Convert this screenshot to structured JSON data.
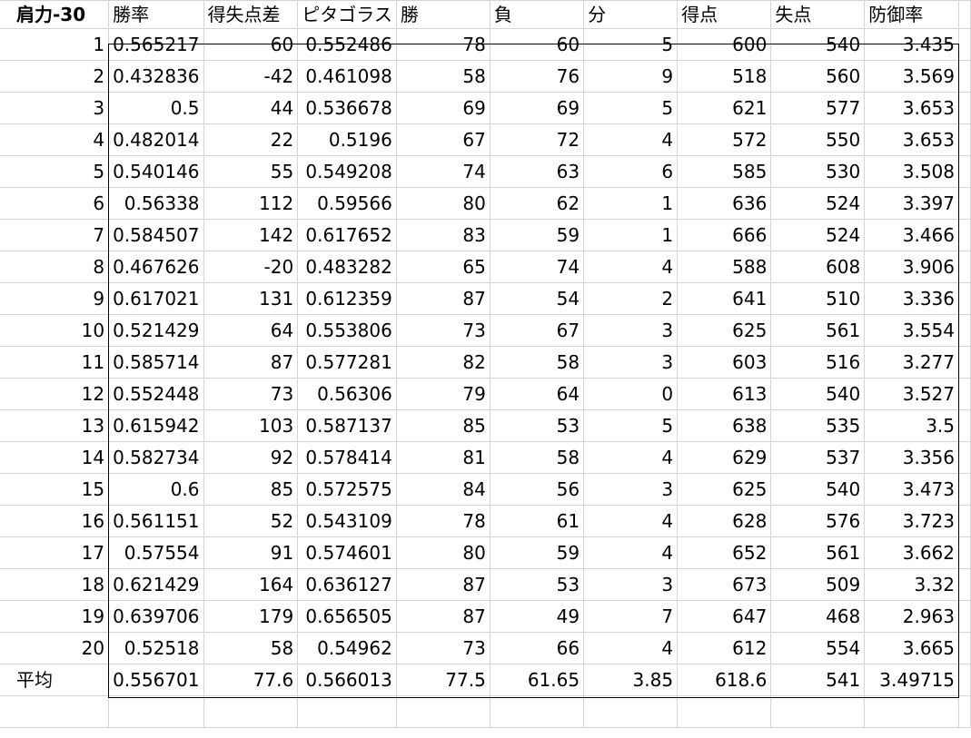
{
  "sheet": {
    "title": "肩力-30",
    "headers": [
      "勝率",
      "得失点差",
      "ピタゴラス",
      "勝",
      "負",
      "分",
      "得点",
      "失点",
      "防御率"
    ],
    "rows": [
      [
        "1",
        "0.565217",
        "60",
        "0.552486",
        "78",
        "60",
        "5",
        "600",
        "540",
        "3.435"
      ],
      [
        "2",
        "0.432836",
        "-42",
        "0.461098",
        "58",
        "76",
        "9",
        "518",
        "560",
        "3.569"
      ],
      [
        "3",
        "0.5",
        "44",
        "0.536678",
        "69",
        "69",
        "5",
        "621",
        "577",
        "3.653"
      ],
      [
        "4",
        "0.482014",
        "22",
        "0.5196",
        "67",
        "72",
        "4",
        "572",
        "550",
        "3.653"
      ],
      [
        "5",
        "0.540146",
        "55",
        "0.549208",
        "74",
        "63",
        "6",
        "585",
        "530",
        "3.508"
      ],
      [
        "6",
        "0.56338",
        "112",
        "0.59566",
        "80",
        "62",
        "1",
        "636",
        "524",
        "3.397"
      ],
      [
        "7",
        "0.584507",
        "142",
        "0.617652",
        "83",
        "59",
        "1",
        "666",
        "524",
        "3.466"
      ],
      [
        "8",
        "0.467626",
        "-20",
        "0.483282",
        "65",
        "74",
        "4",
        "588",
        "608",
        "3.906"
      ],
      [
        "9",
        "0.617021",
        "131",
        "0.612359",
        "87",
        "54",
        "2",
        "641",
        "510",
        "3.336"
      ],
      [
        "10",
        "0.521429",
        "64",
        "0.553806",
        "73",
        "67",
        "3",
        "625",
        "561",
        "3.554"
      ],
      [
        "11",
        "0.585714",
        "87",
        "0.577281",
        "82",
        "58",
        "3",
        "603",
        "516",
        "3.277"
      ],
      [
        "12",
        "0.552448",
        "73",
        "0.56306",
        "79",
        "64",
        "0",
        "613",
        "540",
        "3.527"
      ],
      [
        "13",
        "0.615942",
        "103",
        "0.587137",
        "85",
        "53",
        "5",
        "638",
        "535",
        "3.5"
      ],
      [
        "14",
        "0.582734",
        "92",
        "0.578414",
        "81",
        "58",
        "4",
        "629",
        "537",
        "3.356"
      ],
      [
        "15",
        "0.6",
        "85",
        "0.572575",
        "84",
        "56",
        "3",
        "625",
        "540",
        "3.473"
      ],
      [
        "16",
        "0.561151",
        "52",
        "0.543109",
        "78",
        "61",
        "4",
        "628",
        "576",
        "3.723"
      ],
      [
        "17",
        "0.57554",
        "91",
        "0.574601",
        "80",
        "59",
        "4",
        "652",
        "561",
        "3.662"
      ],
      [
        "18",
        "0.621429",
        "164",
        "0.636127",
        "87",
        "53",
        "3",
        "673",
        "509",
        "3.32"
      ],
      [
        "19",
        "0.639706",
        "179",
        "0.656505",
        "87",
        "49",
        "7",
        "647",
        "468",
        "2.963"
      ],
      [
        "20",
        "0.52518",
        "58",
        "0.54962",
        "73",
        "66",
        "4",
        "612",
        "554",
        "3.665"
      ]
    ],
    "average": [
      "平均",
      "0.556701",
      "77.6",
      "0.566013",
      "77.5",
      "61.65",
      "3.85",
      "618.6",
      "541",
      "3.49715"
    ]
  },
  "colors": {
    "gridline": "#d4d4d4",
    "border": "#000000"
  }
}
